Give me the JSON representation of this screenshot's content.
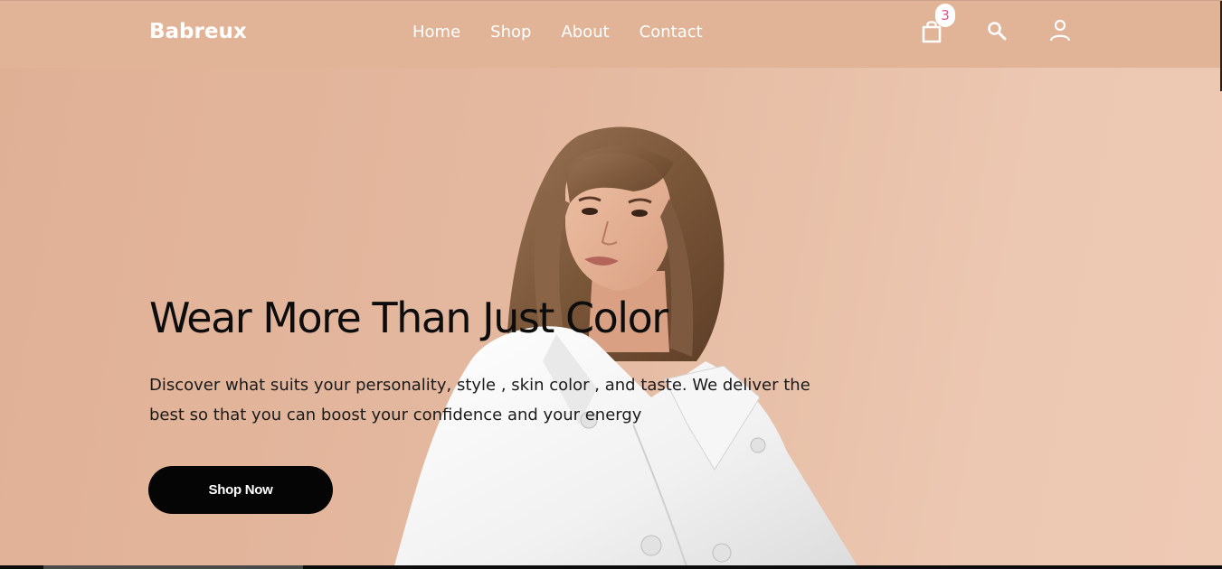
{
  "brand": {
    "logo_text": "Babreux"
  },
  "nav": {
    "links": [
      {
        "label": "Home"
      },
      {
        "label": "Shop"
      },
      {
        "label": "About"
      },
      {
        "label": "Contact"
      }
    ]
  },
  "header_icons": {
    "cart": {
      "icon": "shopping-bag-icon",
      "badge_count": "3"
    },
    "search": {
      "icon": "search-icon"
    },
    "account": {
      "icon": "user-icon"
    }
  },
  "hero": {
    "title": "Wear More Than Just Color",
    "description": "Discover what suits your personality, style , skin color , and taste. We deliver the best so that you can boost your confidence and your energy",
    "cta_label": "Shop Now"
  },
  "colors": {
    "background": "#e4b9a0",
    "navbar": "#e1b397",
    "cta_background": "#050505",
    "badge_text": "#e4508a"
  }
}
